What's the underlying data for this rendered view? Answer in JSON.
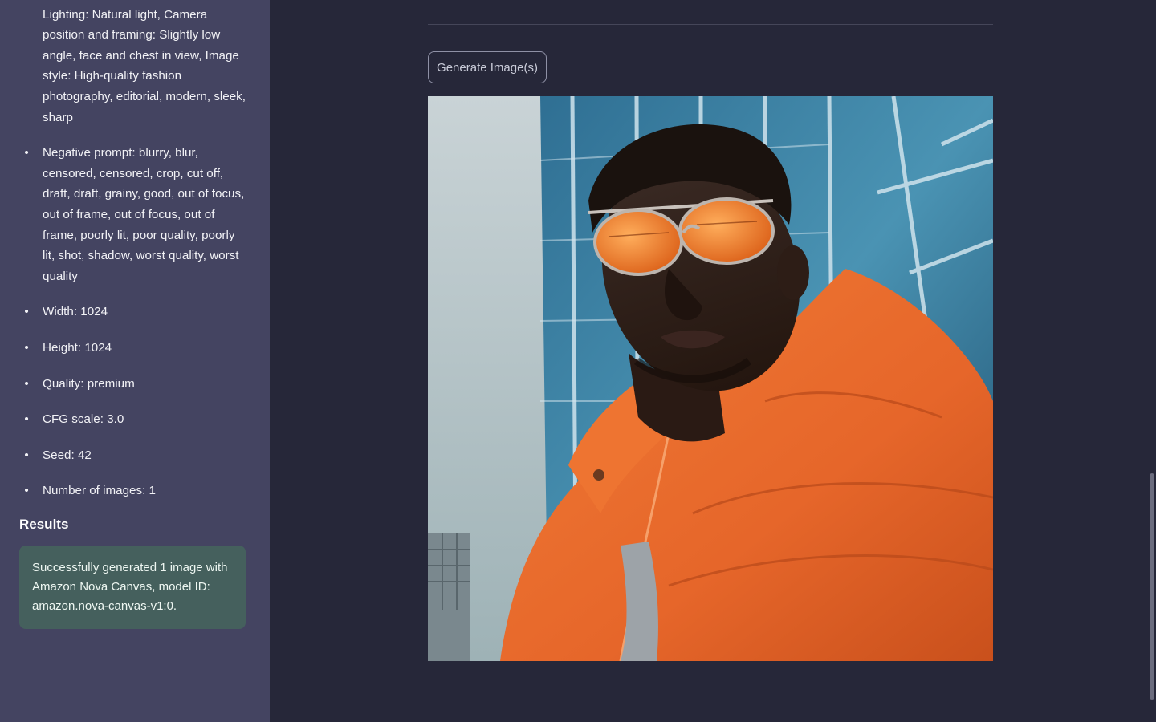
{
  "sidebar": {
    "params": [
      "Standing in front of the building, Lighting: Natural light, Camera position and framing: Slightly low angle, face and chest in view, Image style: High-quality fashion photography, editorial, modern, sleek, sharp",
      "Negative prompt: blurry, blur, censored, censored, crop, cut off, draft, draft, grainy, good, out of focus, out of frame, out of focus, out of frame, poorly lit, poor quality, poorly lit, shot, shadow, worst quality, worst quality",
      "Width: 1024",
      "Height: 1024",
      "Quality: premium",
      "CFG scale: 3.0",
      "Seed: 42",
      "Number of images: 1"
    ],
    "results_heading": "Results",
    "success_message": "Successfully generated 1 image with Amazon Nova Canvas, model ID: amazon.nova-canvas-v1:0."
  },
  "main": {
    "generate_button_label": "Generate Image(s)"
  },
  "colors": {
    "sidebar_bg": "#444461",
    "main_bg": "#262739",
    "success_bg": "#45605d",
    "jacket_orange": "#e8692a"
  }
}
